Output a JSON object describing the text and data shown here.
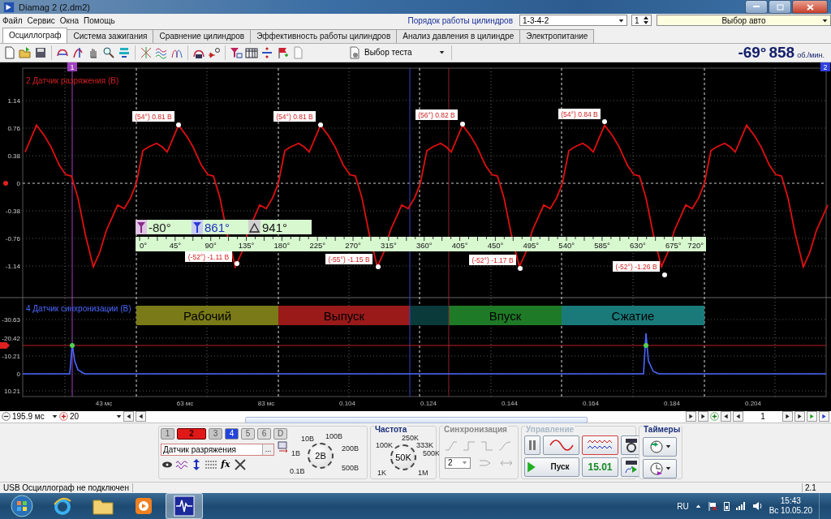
{
  "window": {
    "title": "Diamag 2 (2.dm2)"
  },
  "menu": [
    "Файл",
    "Сервис",
    "Окна",
    "Помощь"
  ],
  "cylinder_order": {
    "label": "Порядок работы цилиндров",
    "value": "1-3-4-2",
    "cylinder": "1",
    "car": "Выбор авто"
  },
  "tabs": [
    {
      "label": "Осциллограф",
      "selected": true
    },
    {
      "label": "Система зажигания",
      "selected": false
    },
    {
      "label": "Сравнение цилиндров",
      "selected": false
    },
    {
      "label": "Эффективность работы цилиндров",
      "selected": false
    },
    {
      "label": "Анализ давления в цилиндре",
      "selected": false
    },
    {
      "label": "Электропитание",
      "selected": false
    }
  ],
  "toolbar": {
    "test_select": "Выбор теста",
    "angle": "-69°",
    "rpm": "858",
    "rpm_unit": "об./мин."
  },
  "cursor_markers": [
    "1",
    "2"
  ],
  "upper_plot": {
    "title": "2 Датчик разряжения (В)",
    "y_ticks": [
      "1.14",
      "0.76",
      "0.38",
      "0",
      "-0.38",
      "-0.76",
      "-1.14"
    ],
    "peaks": [
      "(54°) 0.81 В",
      "(54°) 0.81 В",
      "(56°) 0.82 В",
      "(54°) 0.84 В"
    ],
    "troughs": [
      "(-52°) -1.11 В",
      "(-55°) -1.15 В",
      "(-52°) -1.17 В",
      "(-52°) -1.26 В"
    ]
  },
  "angle_ruler": {
    "cursor_1": "-80°",
    "cursor_2": "861°",
    "delta": "941°",
    "labels": [
      "0°",
      "45°",
      "90°",
      "135°",
      "180°",
      "225°",
      "270°",
      "315°",
      "360°",
      "405°",
      "450°",
      "495°",
      "540°",
      "585°",
      "630°",
      "675°",
      "720°"
    ]
  },
  "lower_plot": {
    "title": "4 Датчик синхронизации (В)",
    "y_ticks": [
      "-30.63",
      "-20.42",
      "-10.21",
      "0",
      "10.21"
    ],
    "phases": [
      {
        "label": "Рабочий",
        "color": "#7a7a18"
      },
      {
        "label": "Выпуск",
        "color": "#9a1a1a"
      },
      {
        "label": "Впуск",
        "color": "#1e7a26"
      },
      {
        "label": "Сжатие",
        "color": "#1a7a7a"
      }
    ]
  },
  "time_axis": [
    "43 мс",
    "63 мс",
    "83 мс",
    "0.104",
    "0.124",
    "0.144",
    "0.164",
    "0.184",
    "0.204"
  ],
  "nav": {
    "time_scale": "195.9 мс",
    "zoom": "20",
    "page": "1"
  },
  "channels": [
    {
      "label": "1",
      "selected": false,
      "color": "#c4c4c4"
    },
    {
      "label": "2",
      "selected": true,
      "color": "#e01818"
    },
    {
      "label": "3",
      "selected": false,
      "color": "#c4c4c4"
    },
    {
      "label": "4",
      "selected": false,
      "color": "#2244dd"
    },
    {
      "label": "5",
      "selected": false,
      "color": "#dadada"
    },
    {
      "label": "6",
      "selected": false,
      "color": "#dadada"
    },
    {
      "label": "D",
      "selected": false,
      "color": "#dadada"
    }
  ],
  "channel_panel": {
    "sensor": "Датчик разряжения",
    "browse": "...",
    "formula": "fx",
    "scale_labels": [
      "10В",
      "100В",
      "200В",
      "500В",
      "0.1В",
      "1В"
    ],
    "knob": "2В"
  },
  "frequency": {
    "title": "Частота",
    "labels": [
      "250K",
      "100K",
      "333K",
      "500K",
      "1K",
      "1M"
    ],
    "knob": "50K"
  },
  "sync": {
    "title": "Синхронизация",
    "channel": "2"
  },
  "control": {
    "title": "Управление",
    "start": "Пуск",
    "value": "15.01"
  },
  "timers": {
    "title": "Таймеры"
  },
  "status_bar": {
    "text": "USB Осциллограф не подключен",
    "version": "2.1"
  },
  "taskbar": {
    "language": "RU",
    "time": "15:43",
    "date": "Вс 10.05.20"
  }
}
